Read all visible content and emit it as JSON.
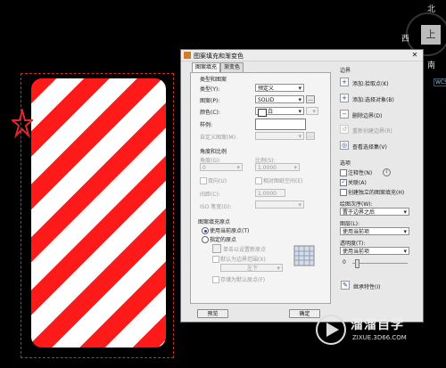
{
  "viewcube": {
    "north": "北",
    "west": "西",
    "top": "上",
    "south": "南",
    "wcs": "WCS"
  },
  "dialog": {
    "title": "图案填充和渐变色",
    "close": "✕",
    "tabs": [
      "图案填充",
      "渐变色"
    ],
    "type_pattern": {
      "section": "类型和图案",
      "type_label": "类型(Y):",
      "type_value": "预定义",
      "pattern_label": "图案(P):",
      "pattern_value": "SOLID",
      "color_label": "颜色(C):",
      "color_value": "白",
      "sample_label": "样例:",
      "custom_label": "自定义图案(M):"
    },
    "angle_scale": {
      "section": "角度和比例",
      "angle_label": "角度(G):",
      "angle_value": "0",
      "scale_label": "比例(S):",
      "scale_value": "1.0000",
      "double_label": "双向(U)",
      "relative_label": "相对图纸空间(E)",
      "spacing_label": "间距(C):",
      "spacing_value": "1.0000",
      "iso_label": "ISO 笔宽(O):"
    },
    "origin": {
      "section": "图案填充原点",
      "current_label": "使用当前原点(T)",
      "specified_label": "指定的原点",
      "click_label": "单击以设置新原点",
      "default_extents_label": "默认为边界范围(X)",
      "position_value": "左下",
      "store_label": "存储为默认原点(F)"
    },
    "boundaries": {
      "section": "边界",
      "pick_points": "添加:拾取点(K)",
      "select_objects": "添加:选择对象(B)",
      "remove": "删除边界(D)",
      "recreate": "重新创建边界(R)",
      "view_selection": "查看选择集(V)"
    },
    "options": {
      "section": "选项",
      "annotative": "注释性(N)",
      "associative": "关联(A)",
      "separate": "创建独立的图案填充(H)",
      "draw_order_label": "绘图次序(W):",
      "draw_order_value": "置于边界之后",
      "layer_label": "图层(L):",
      "layer_value": "使用当前项",
      "transparency_label": "透明度(T):",
      "transparency_value": "使用当前项",
      "transparency_amount": "0"
    },
    "inherit": "继承特性(I)",
    "preview": "预览",
    "ok": "确定"
  },
  "watermark": {
    "name": "溜溜自学",
    "url": "ZIXUE.3D66.COM"
  },
  "colors": {
    "stripe_red": "#ff1a1a",
    "frame_dash": "#c9302c",
    "canvas_bg": "#000000"
  }
}
